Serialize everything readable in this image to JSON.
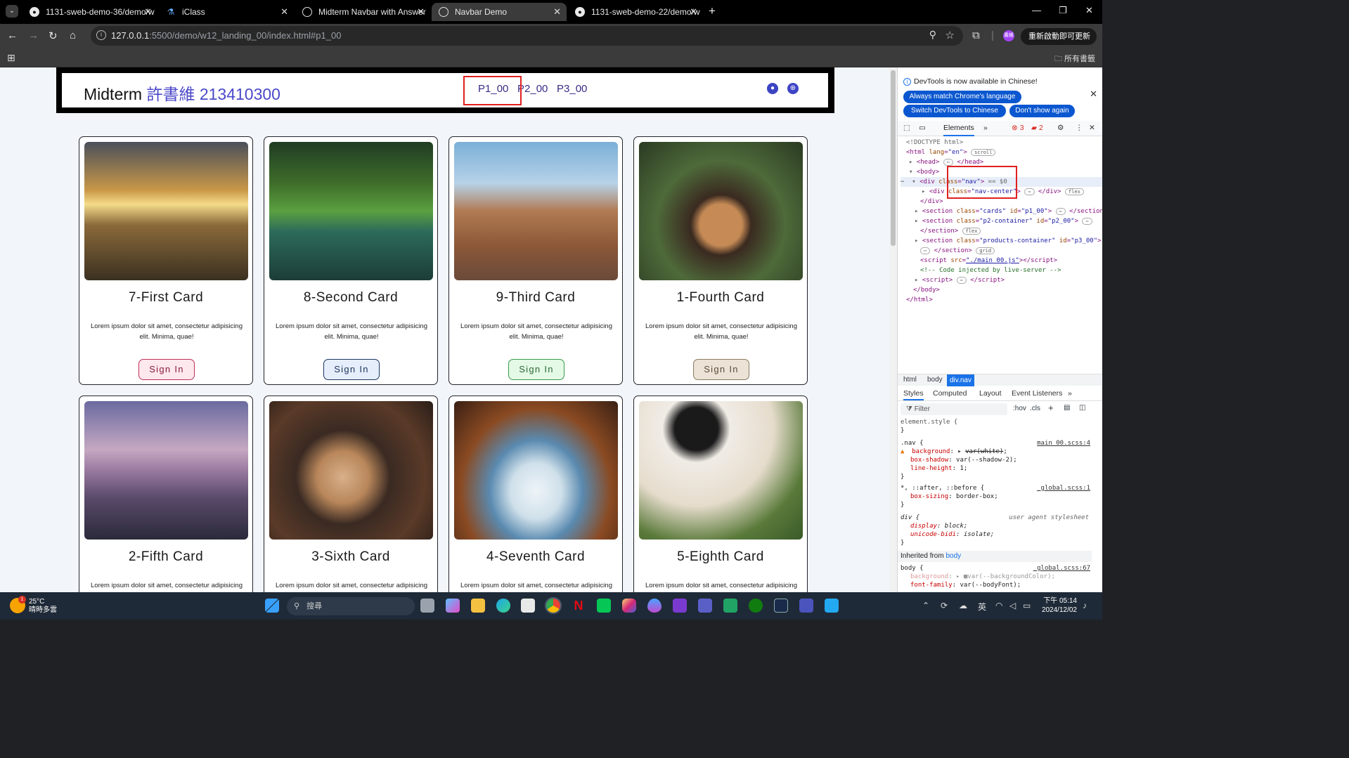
{
  "tabs": [
    {
      "title": "1131-sweb-demo-36/demo/w",
      "icon": "github-icon"
    },
    {
      "title": "iClass",
      "icon": "iclass-icon"
    },
    {
      "title": "Midterm Navbar with Answer",
      "icon": "globe-icon"
    },
    {
      "title": "Navbar Demo",
      "icon": "globe-icon",
      "active": true
    },
    {
      "title": "1131-sweb-demo-22/demo/w",
      "icon": "github-icon"
    }
  ],
  "toolbar": {
    "url_host": "127.0.0.1",
    "url_rest": ":5500/demo/w12_landing_00/index.html#p1_00",
    "profile_label": "書維",
    "update_label": "重新啟動即可更新"
  },
  "bookmarks": {
    "all_label": "所有書籤"
  },
  "page": {
    "brand_prefix": "Midterm",
    "brand_name": "許書維 213410300",
    "nav_links": [
      "P1_00",
      "P2_00",
      "P3_00"
    ],
    "cards": [
      {
        "title": "7-First Card",
        "text": "Lorem ipsum dolor sit amet, consectetur adipisicing elit. Minima, quae!",
        "button": "Sign In",
        "btn_bg": "#fde8ee",
        "btn_border": "#c03058",
        "img": "mountain-sunset"
      },
      {
        "title": "8-Second Card",
        "text": "Lorem ipsum dolor sit amet, consectetur adipisicing elit. Minima, quae!",
        "button": "Sign In",
        "btn_bg": "#e6eefc",
        "btn_border": "#1c3560",
        "img": "forest-river"
      },
      {
        "title": "9-Third Card",
        "text": "Lorem ipsum dolor sit amet, consectetur adipisicing elit. Minima, quae!",
        "button": "Sign In",
        "btn_bg": "#e4f9e6",
        "btn_border": "#3a9a4a",
        "img": "rock-formations"
      },
      {
        "title": "1-Fourth Card",
        "text": "Lorem ipsum dolor sit amet, consectetur adipisicing elit. Minima, quae!",
        "button": "Sign In",
        "btn_bg": "#ece3d6",
        "btn_border": "#8a7a62",
        "img": "latte-art"
      },
      {
        "title": "2-Fifth Card",
        "text": "Lorem ipsum dolor sit amet, consectetur adipisicing",
        "img": "bridge-night"
      },
      {
        "title": "3-Sixth Card",
        "text": "Lorem ipsum dolor sit amet, consectetur adipisicing",
        "img": "coffee-cheers"
      },
      {
        "title": "4-Seventh Card",
        "text": "Lorem ipsum dolor sit amet, consectetur adipisicing",
        "img": "coffee-cup"
      },
      {
        "title": "5-Eighth Card",
        "text": "Lorem ipsum dolor sit amet, consectetur adipisicing",
        "img": "coffee-note"
      }
    ]
  },
  "devtools": {
    "banner": "DevTools is now available in Chinese!",
    "btn_match": "Always match Chrome's language",
    "btn_switch": "Switch DevTools to Chinese",
    "btn_dont": "Don't show again",
    "tab_elements": "Elements",
    "errors": "3",
    "warnings": "2",
    "crumbs": [
      "html",
      "body",
      "div.nav"
    ],
    "style_tabs": [
      "Styles",
      "Computed",
      "Layout",
      "Event Listeners"
    ],
    "filter_placeholder": "Filter",
    "hov": ":hov",
    "cls": ".cls",
    "inherited": "Inherited from",
    "inherited_link": "body"
  },
  "taskbar": {
    "temp": "25°C",
    "weather": "晴時多雲",
    "weather_badge": "1",
    "search": "搜尋",
    "ime": "英",
    "time": "下午 05:14",
    "date": "2024/12/02"
  }
}
